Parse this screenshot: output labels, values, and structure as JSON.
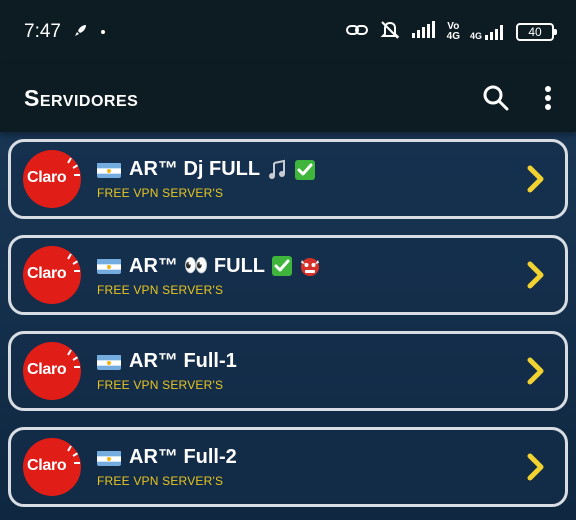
{
  "status_bar": {
    "time": "7:47",
    "network_top": "Vo",
    "network_bottom": "4G",
    "network2_top": "4G",
    "battery": "40"
  },
  "app_bar": {
    "title": "Servidores",
    "icons": [
      "search-icon",
      "more-vert-icon"
    ]
  },
  "colors": {
    "app_bar_bg": "#0d1b22",
    "card_border": "#d8dde3",
    "subtitle": "#e8c620",
    "chevron": "#f1d230",
    "logo_bg": "#e11d17"
  },
  "servers": [
    {
      "logo": "Claro",
      "name": "AR™ Dj FULL",
      "emojis": [
        "music-note-icon",
        "check-mark-icon"
      ],
      "subtitle": "FREE VPN SERVER'S"
    },
    {
      "logo": "Claro",
      "name": "AR™ 👀 FULL",
      "emojis": [
        "check-mark-icon",
        "goblin-mask-icon"
      ],
      "subtitle": "FREE VPN SERVER'S"
    },
    {
      "logo": "Claro",
      "name": "AR™ Full-1",
      "emojis": [],
      "subtitle": "FREE VPN SERVER'S"
    },
    {
      "logo": "Claro",
      "name": "AR™ Full-2",
      "emojis": [],
      "subtitle": "FREE VPN SERVER'S"
    }
  ]
}
